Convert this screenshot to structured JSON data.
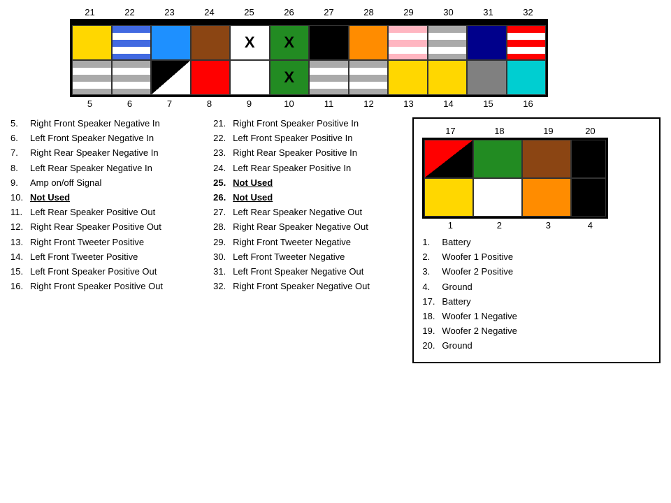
{
  "connector": {
    "topPins": [
      "21",
      "22",
      "23",
      "24",
      "25",
      "26",
      "27",
      "28",
      "29",
      "30",
      "31",
      "32"
    ],
    "bottomPins": [
      "5",
      "6",
      "7",
      "8",
      "9",
      "10",
      "11",
      "12",
      "13",
      "14",
      "15",
      "16"
    ],
    "rows": [
      [
        {
          "bg": "#ffd700",
          "style": ""
        },
        {
          "bg": "#fff",
          "style": "stripe-blue-white"
        },
        {
          "bg": "#1e90ff",
          "style": ""
        },
        {
          "bg": "#8B4513",
          "style": ""
        },
        {
          "bg": "#fff",
          "style": "",
          "label": "X"
        },
        {
          "bg": "#228B22",
          "style": "",
          "label": "X"
        },
        {
          "bg": "#000",
          "style": ""
        },
        {
          "bg": "#ff8c00",
          "style": ""
        },
        {
          "bg": "#ffb6c1",
          "style": ""
        },
        {
          "bg": "#aaa",
          "style": ""
        },
        {
          "bg": "#00008B",
          "style": ""
        },
        {
          "bg": "#ff0000",
          "style": "stripe-red-white"
        }
      ],
      [
        {
          "bg": "#aaa",
          "style": "stripe-gray-white"
        },
        {
          "bg": "#fff",
          "style": "stripe-gray-white"
        },
        {
          "bg": "#000",
          "style": "diagonal"
        },
        {
          "bg": "#ff0000",
          "style": ""
        },
        {
          "bg": "#fff",
          "style": ""
        },
        {
          "bg": "#228B22",
          "style": "",
          "label": "X"
        },
        {
          "bg": "#fff",
          "style": "stripe-gray-white"
        },
        {
          "bg": "#aaa",
          "style": "stripe-gray-white"
        },
        {
          "bg": "#ffd700",
          "style": ""
        },
        {
          "bg": "#ffd700",
          "style": ""
        },
        {
          "bg": "#808080",
          "style": ""
        },
        {
          "bg": "#00ced1",
          "style": ""
        }
      ]
    ]
  },
  "leftLegend": [
    {
      "num": "5.",
      "text": "Right Front Speaker Negative In",
      "bold": false
    },
    {
      "num": "6.",
      "text": "Left Front Speaker Negative In",
      "bold": false
    },
    {
      "num": "7.",
      "text": "Right Rear Speaker Negative In",
      "bold": false
    },
    {
      "num": "8.",
      "text": "Left Rear Speaker Negative In",
      "bold": false
    },
    {
      "num": "9.",
      "text": "Amp on/off Signal",
      "bold": false
    },
    {
      "num": "10.",
      "text": "Not Used",
      "bold": true
    },
    {
      "num": "11.",
      "text": "Left Rear Speaker Positive Out",
      "bold": false
    },
    {
      "num": "12.",
      "text": "Right Rear Speaker Positive Out",
      "bold": false
    },
    {
      "num": "13.",
      "text": "Right Front Tweeter Positive",
      "bold": false
    },
    {
      "num": "14.",
      "text": "Left Front Tweeter Positive",
      "bold": false
    },
    {
      "num": "15.",
      "text": "Left Front Speaker Positive Out",
      "bold": false
    },
    {
      "num": "16.",
      "text": "Right Front Speaker Positive Out",
      "bold": false
    }
  ],
  "middleLegend": [
    {
      "num": "21.",
      "text": "Right Front Speaker Positive In",
      "bold": false
    },
    {
      "num": "22.",
      "text": "Left Front Speaker Positive In",
      "bold": false
    },
    {
      "num": "23.",
      "text": "Right Rear Speaker Positive In",
      "bold": false
    },
    {
      "num": "24.",
      "text": "Left Rear Speaker Positive In",
      "bold": false
    },
    {
      "num": "25.",
      "text": "Not Used",
      "bold": true
    },
    {
      "num": "26.",
      "text": "Not Used",
      "bold": true
    },
    {
      "num": "27.",
      "text": "Left Rear Speaker Negative Out",
      "bold": false
    },
    {
      "num": "28.",
      "text": "Right Rear Speaker Negative Out",
      "bold": false
    },
    {
      "num": "29.",
      "text": "Right Front Tweeter Negative",
      "bold": false
    },
    {
      "num": "30.",
      "text": "Left Front Tweeter Negative",
      "bold": false
    },
    {
      "num": "31.",
      "text": "Left Front Speaker Negative Out",
      "bold": false
    },
    {
      "num": "32.",
      "text": "Right Front Speaker Negative Out",
      "bold": false
    }
  ],
  "smallConnector": {
    "topPins": [
      "17",
      "18",
      "19",
      "20"
    ],
    "bottomPins": [
      "1",
      "2",
      "3",
      "4"
    ],
    "rows": [
      [
        {
          "bg": "diagonal-red-black"
        },
        {
          "bg": "#228B22"
        },
        {
          "bg": "#8B4513"
        },
        {
          "bg": "#000"
        }
      ],
      [
        {
          "bg": "#ffd700"
        },
        {
          "bg": "#fff"
        },
        {
          "bg": "#ff8c00"
        },
        {
          "bg": "#000"
        }
      ]
    ]
  },
  "rightLegend": [
    {
      "num": "1.",
      "text": "Battery"
    },
    {
      "num": "2.",
      "text": "Woofer 1 Positive"
    },
    {
      "num": "3.",
      "text": "Woofer 2 Positive"
    },
    {
      "num": "4.",
      "text": "Ground"
    },
    {
      "num": "17.",
      "text": "Battery"
    },
    {
      "num": "18.",
      "text": "Woofer 1 Negative"
    },
    {
      "num": "19.",
      "text": "Woofer 2 Negative"
    },
    {
      "num": "20.",
      "text": "Ground"
    }
  ]
}
